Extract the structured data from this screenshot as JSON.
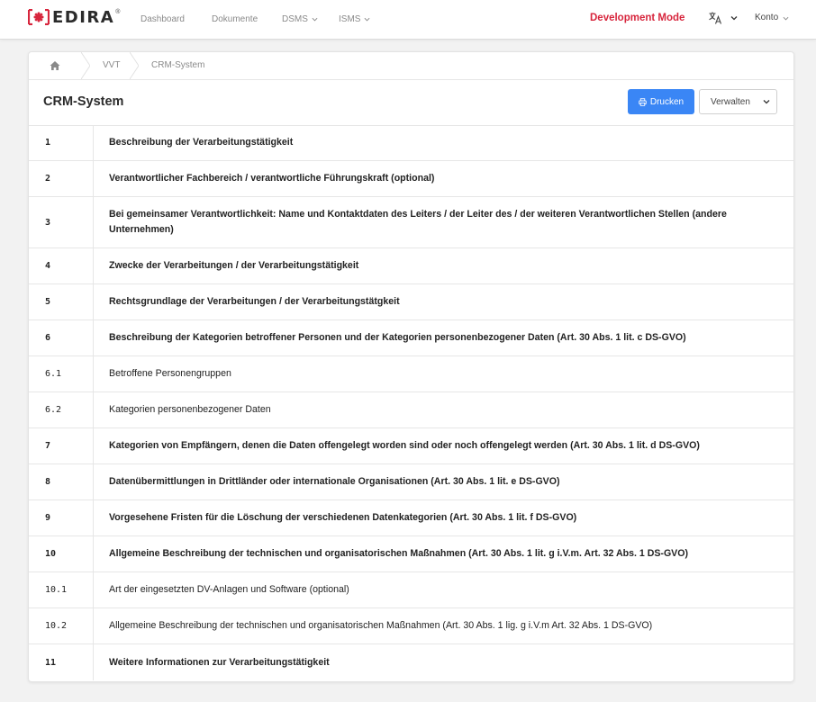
{
  "navbar": {
    "brand": "EDIRA",
    "brand_reg": "®",
    "items": [
      {
        "label": "Dashboard"
      },
      {
        "label": "Dokumente"
      },
      {
        "label": "DSMS"
      },
      {
        "label": "ISMS"
      }
    ],
    "dev_mode": "Development Mode",
    "language_icon": "translate-icon",
    "account": "Konto"
  },
  "breadcrumb": {
    "home_icon": "home-icon",
    "items": [
      "VVT",
      "CRM-System"
    ]
  },
  "header": {
    "title": "CRM-System",
    "print_label": "Drucken",
    "manage_label": "Verwalten"
  },
  "colors": {
    "accent": "#3a86f5",
    "dev_mode": "#d7263d",
    "brand_red": "#d7263d"
  },
  "rows": [
    {
      "num": "1",
      "text": "Beschreibung der Verarbeitungstätigkeit",
      "bold": true
    },
    {
      "num": "2",
      "text": "Verantwortlicher Fachbereich / verantwortliche Führungskraft (optional)",
      "bold": true
    },
    {
      "num": "3",
      "text": "Bei gemeinsamer Verantwortlichkeit: Name und Kontaktdaten des Leiters / der Leiter des / der weiteren Verantwortlichen Stellen (andere Unternehmen)",
      "bold": true
    },
    {
      "num": "4",
      "text": "Zwecke der Verarbeitungen / der Verarbeitungstätigkeit",
      "bold": true
    },
    {
      "num": "5",
      "text": "Rechtsgrundlage der Verarbeitungen / der Verarbeitungstätgkeit",
      "bold": true
    },
    {
      "num": "6",
      "text": "Beschreibung der Kategorien betroffener Personen und der Kategorien personenbezogener Daten (Art. 30 Abs. 1 lit. c DS-GVO)",
      "bold": true
    },
    {
      "num": "6.1",
      "text": "Betroffene Personengruppen",
      "bold": false
    },
    {
      "num": "6.2",
      "text": "Kategorien personenbezogener Daten",
      "bold": false
    },
    {
      "num": "7",
      "text": "Kategorien von Empfängern, denen die Daten offengelegt worden sind oder noch offengelegt werden (Art. 30 Abs. 1 lit. d DS-GVO)",
      "bold": true
    },
    {
      "num": "8",
      "text": "Datenübermittlungen in Drittländer oder internationale Organisationen (Art. 30 Abs. 1 lit. e DS-GVO)",
      "bold": true
    },
    {
      "num": "9",
      "text": "Vorgesehene Fristen für die Löschung der verschiedenen Datenkategorien (Art. 30 Abs. 1 lit. f DS-GVO)",
      "bold": true
    },
    {
      "num": "10",
      "text": "Allgemeine Beschreibung der technischen und organisatorischen Maßnahmen (Art. 30 Abs. 1 lit. g i.V.m. Art. 32 Abs. 1 DS-GVO)",
      "bold": true
    },
    {
      "num": "10.1",
      "text": "Art der eingesetzten DV-Anlagen und Software (optional)",
      "bold": false
    },
    {
      "num": "10.2",
      "text": "Allgemeine Beschreibung der technischen und organisatorischen Maßnahmen (Art. 30 Abs. 1 lig. g i.V.m Art. 32 Abs. 1 DS-GVO)",
      "bold": false
    },
    {
      "num": "11",
      "text": "Weitere Informationen zur Verarbeitungstätigkeit",
      "bold": true
    }
  ]
}
